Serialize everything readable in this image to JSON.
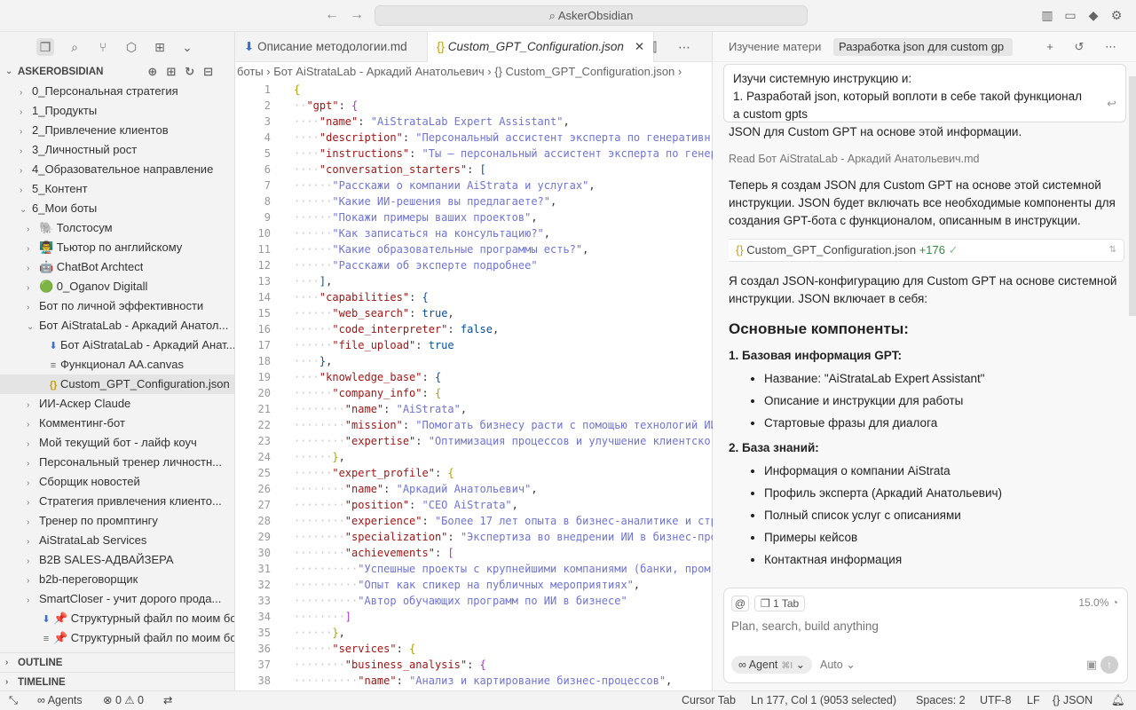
{
  "titlebar": {
    "search": "AskerObsidian",
    "back": "←",
    "forward": "→"
  },
  "sidebar": {
    "title": "ASKEROBSIDIAN",
    "items": [
      {
        "label": "0_Персональная стратегия",
        "indent": 0,
        "chev": "›",
        "icon": ""
      },
      {
        "label": "1_Продукты",
        "indent": 0,
        "chev": "›",
        "icon": ""
      },
      {
        "label": "2_Привлечение клиентов",
        "indent": 0,
        "chev": "›",
        "icon": ""
      },
      {
        "label": "3_Личностный рост",
        "indent": 0,
        "chev": "›",
        "icon": ""
      },
      {
        "label": "4_Образовательное направление",
        "indent": 0,
        "chev": "›",
        "icon": ""
      },
      {
        "label": "5_Контент",
        "indent": 0,
        "chev": "›",
        "icon": ""
      },
      {
        "label": "6_Мои боты",
        "indent": 0,
        "chev": "⌄",
        "icon": ""
      },
      {
        "label": "🐘 Толстосум",
        "indent": 1,
        "chev": "›",
        "icon": ""
      },
      {
        "label": "👨‍🏫 Тьютор по английскому",
        "indent": 1,
        "chev": "›",
        "icon": ""
      },
      {
        "label": "🤖 ChatBot Archtect",
        "indent": 1,
        "chev": "›",
        "icon": ""
      },
      {
        "label": "🟢 0_Oganov Digitall",
        "indent": 1,
        "chev": "›",
        "icon": ""
      },
      {
        "label": "Бот по личной эффективности",
        "indent": 1,
        "chev": "›",
        "icon": ""
      },
      {
        "label": "Бот AiStrataLab - Аркадий Анатол...",
        "indent": 1,
        "chev": "⌄",
        "icon": ""
      },
      {
        "label": "Бот AiStrataLab - Аркадий Анат...",
        "indent": 2,
        "chev": "",
        "icon": "⬇"
      },
      {
        "label": "Функционал AA.canvas",
        "indent": 2,
        "chev": "",
        "icon": "≡"
      },
      {
        "label": "Custom_GPT_Configuration.json",
        "indent": 2,
        "chev": "",
        "icon": "{}",
        "selected": true
      },
      {
        "label": "ИИ-Аскер Claude",
        "indent": 1,
        "chev": "›",
        "icon": ""
      },
      {
        "label": "Комментинг-бот",
        "indent": 1,
        "chev": "›",
        "icon": ""
      },
      {
        "label": "Мой текущий бот - лайф коуч",
        "indent": 1,
        "chev": "›",
        "icon": ""
      },
      {
        "label": "Персональный тренер личностн...",
        "indent": 1,
        "chev": "›",
        "icon": ""
      },
      {
        "label": "Сборщик новостей",
        "indent": 1,
        "chev": "›",
        "icon": ""
      },
      {
        "label": "Стратегия привлечения клиенто...",
        "indent": 1,
        "chev": "›",
        "icon": ""
      },
      {
        "label": "Тренер по промптингу",
        "indent": 1,
        "chev": "›",
        "icon": ""
      },
      {
        "label": "AiStrataLab Services",
        "indent": 1,
        "chev": "›",
        "icon": ""
      },
      {
        "label": "B2B SALES-АДВАЙЗЕРА",
        "indent": 1,
        "chev": "›",
        "icon": ""
      },
      {
        "label": "b2b-переговорщик",
        "indent": 1,
        "chev": "›",
        "icon": ""
      },
      {
        "label": "SmartCloser - учит дорого прода...",
        "indent": 1,
        "chev": "›",
        "icon": ""
      },
      {
        "label": "📌 Структурный файл по моим бо...",
        "indent": 1,
        "chev": "",
        "icon": "⬇"
      },
      {
        "label": "📌 Структурный файл по моим бо...",
        "indent": 1,
        "chev": "",
        "icon": "≡"
      }
    ],
    "outline": "OUTLINE",
    "timeline": "TIMELINE"
  },
  "editor": {
    "tabs": [
      {
        "label": "Описание методологии.md",
        "active": false
      },
      {
        "label": "Custom_GPT_Configuration.json",
        "active": true
      }
    ],
    "breadcrumb": "боты  ›  Бот AiStrataLab - Аркадий Анатольевич  ›  {}  Custom_GPT_Configuration.json  ›",
    "lines": [
      {
        "n": 1,
        "ind": 0,
        "html": "<span class='br1'>{</span>"
      },
      {
        "n": 2,
        "ind": 1,
        "html": "<span class='k'>\"gpt\"</span><span class='p'>: </span><span class='br2'>{</span>"
      },
      {
        "n": 3,
        "ind": 2,
        "html": "<span class='k'>\"name\"</span><span class='p'>: </span><span class='s'>\"AiStrataLab Expert Assistant\"</span><span class='p'>,</span>"
      },
      {
        "n": 4,
        "ind": 2,
        "html": "<span class='k'>\"description\"</span><span class='p'>: </span><span class='s'>\"Персональный ассистент эксперта по генеративн</span>"
      },
      {
        "n": 5,
        "ind": 2,
        "html": "<span class='k'>\"instructions\"</span><span class='p'>: </span><span class='s'>\"Ты — персональный ассистент эксперта по генер</span>"
      },
      {
        "n": 6,
        "ind": 2,
        "html": "<span class='k'>\"conversation_starters\"</span><span class='p'>: </span><span class='b'>[</span>"
      },
      {
        "n": 7,
        "ind": 3,
        "html": "<span class='s'>\"Расскажи о компании AiStrata и услугах\"</span><span class='p'>,</span>"
      },
      {
        "n": 8,
        "ind": 3,
        "html": "<span class='s'>\"Какие ИИ-решения вы предлагаете?\"</span><span class='p'>,</span>"
      },
      {
        "n": 9,
        "ind": 3,
        "html": "<span class='s'>\"Покажи примеры ваших проектов\"</span><span class='p'>,</span>"
      },
      {
        "n": 10,
        "ind": 3,
        "html": "<span class='s'>\"Как записаться на консультацию?\"</span><span class='p'>,</span>"
      },
      {
        "n": 11,
        "ind": 3,
        "html": "<span class='s'>\"Какие образовательные программы есть?\"</span><span class='p'>,</span>"
      },
      {
        "n": 12,
        "ind": 3,
        "html": "<span class='s'>\"Расскажи об эксперте подробнее\"</span>"
      },
      {
        "n": 13,
        "ind": 2,
        "html": "<span class='b'>]</span><span class='p'>,</span>"
      },
      {
        "n": 14,
        "ind": 2,
        "html": "<span class='k'>\"capabilities\"</span><span class='p'>: </span><span class='b'>{</span>"
      },
      {
        "n": 15,
        "ind": 3,
        "html": "<span class='k'>\"web_search\"</span><span class='p'>: </span><span class='b'>true</span><span class='p'>,</span>"
      },
      {
        "n": 16,
        "ind": 3,
        "html": "<span class='k'>\"code_interpreter\"</span><span class='p'>: </span><span class='b'>false</span><span class='p'>,</span>"
      },
      {
        "n": 17,
        "ind": 3,
        "html": "<span class='k'>\"file_upload\"</span><span class='p'>: </span><span class='b'>true</span>"
      },
      {
        "n": 18,
        "ind": 2,
        "html": "<span class='b'>}</span><span class='p'>,</span>"
      },
      {
        "n": 19,
        "ind": 2,
        "html": "<span class='k'>\"knowledge_base\"</span><span class='p'>: </span><span class='b'>{</span>"
      },
      {
        "n": 20,
        "ind": 3,
        "html": "<span class='k'>\"company_info\"</span><span class='p'>: </span><span class='br1'>{</span>"
      },
      {
        "n": 21,
        "ind": 4,
        "html": "<span class='k'>\"name\"</span><span class='p'>: </span><span class='s'>\"AiStrata\"</span><span class='p'>,</span>"
      },
      {
        "n": 22,
        "ind": 4,
        "html": "<span class='k'>\"mission\"</span><span class='p'>: </span><span class='s'>\"Помогать бизнесу расти с помощью технологий ИИ</span>"
      },
      {
        "n": 23,
        "ind": 4,
        "html": "<span class='k'>\"expertise\"</span><span class='p'>: </span><span class='s'>\"Оптимизация процессов и улучшение клиентско</span>"
      },
      {
        "n": 24,
        "ind": 3,
        "html": "<span class='br1'>}</span><span class='p'>,</span>"
      },
      {
        "n": 25,
        "ind": 3,
        "html": "<span class='k'>\"expert_profile\"</span><span class='p'>: </span><span class='br1'>{</span>"
      },
      {
        "n": 26,
        "ind": 4,
        "html": "<span class='k'>\"name\"</span><span class='p'>: </span><span class='s'>\"Аркадий Анатольевич\"</span><span class='p'>,</span>"
      },
      {
        "n": 27,
        "ind": 4,
        "html": "<span class='k'>\"position\"</span><span class='p'>: </span><span class='s'>\"CEO AiStrata\"</span><span class='p'>,</span>"
      },
      {
        "n": 28,
        "ind": 4,
        "html": "<span class='k'>\"experience\"</span><span class='p'>: </span><span class='s'>\"Более 17 лет опыта в бизнес-аналитике и стр</span>"
      },
      {
        "n": 29,
        "ind": 4,
        "html": "<span class='k'>\"specialization\"</span><span class='p'>: </span><span class='s'>\"Экспертиза во внедрении ИИ в бизнес-про</span>"
      },
      {
        "n": 30,
        "ind": 4,
        "html": "<span class='k'>\"achievements\"</span><span class='p'>: </span><span class='br2'>[</span>"
      },
      {
        "n": 31,
        "ind": 5,
        "html": "<span class='s'>\"Успешные проекты с крупнейшими компаниями (банки, пром</span>"
      },
      {
        "n": 32,
        "ind": 5,
        "html": "<span class='s'>\"Опыт как спикер на публичных мероприятиях\"</span><span class='p'>,</span>"
      },
      {
        "n": 33,
        "ind": 5,
        "html": "<span class='s'>\"Автор обучающих программ по ИИ в бизнесе\"</span>"
      },
      {
        "n": 34,
        "ind": 4,
        "html": "<span class='br2'>]</span>"
      },
      {
        "n": 35,
        "ind": 3,
        "html": "<span class='br1'>}</span><span class='p'>,</span>"
      },
      {
        "n": 36,
        "ind": 3,
        "html": "<span class='k'>\"services\"</span><span class='p'>: </span><span class='br1'>{</span>"
      },
      {
        "n": 37,
        "ind": 4,
        "html": "<span class='k'>\"business_analysis\"</span><span class='p'>: </span><span class='br2'>{</span>"
      },
      {
        "n": 38,
        "ind": 5,
        "html": "<span class='k'>\"name\"</span><span class='p'>: </span><span class='s'>\"Анализ и картирование бизнес-процессов\"</span><span class='p'>,</span>"
      }
    ]
  },
  "chat": {
    "tabs": [
      {
        "label": "Изучение матери",
        "active": false
      },
      {
        "label": "Разработка json для custom gp",
        "active": true
      }
    ],
    "user_line1": "Изучи системную инструкцию и:",
    "user_line2": "1. Разработай json, который воплоти в себе такой функционал",
    "user_line3": "а custom gpts",
    "partial": "JSON для Custom GPT на основе этой информации.",
    "read_label": "Read",
    "read_file": "Бот AiStrataLab - Аркадий Анатольевич.md",
    "p1": "Теперь я создам JSON для Custom GPT на основе этой системной инструкции. JSON будет включать все необходимые компоненты для создания GPT-бота с функционалом, описанным в инструкции.",
    "chip_file": "Custom_GPT_Configuration.json",
    "chip_add": "+176",
    "p2": "Я создал JSON-конфигурацию для Custom GPT на основе системной инструкции. JSON включает в себя:",
    "heading": "Основные компоненты:",
    "sec1": "1. Базовая информация GPT:",
    "sec1_items": [
      "Название: \"AiStrataLab Expert Assistant\"",
      "Описание и инструкции для работы",
      "Стартовые фразы для диалога"
    ],
    "sec2": "2. База знаний:",
    "sec2_items": [
      "Информация о компании AiStrata",
      "Профиль эксперта (Аркадий Анатольевич)",
      "Полный список услуг с описаниями",
      "Примеры кейсов",
      "Контактная информация"
    ]
  },
  "composer": {
    "at": "@",
    "tab": "1 Tab",
    "pct": "15.0%",
    "placeholder": "Plan, search, build anything",
    "agent": "Agent",
    "agent_shortcut": "⌘I",
    "auto": "Auto"
  },
  "status": {
    "agents": "Agents",
    "problems": "⊗ 0 ⚠ 0",
    "cursor_tab": "Cursor Tab",
    "position": "Ln 177, Col 1 (9053 selected)",
    "spaces": "Spaces: 2",
    "encoding": "UTF-8",
    "eol": "LF",
    "lang": "{} JSON"
  }
}
